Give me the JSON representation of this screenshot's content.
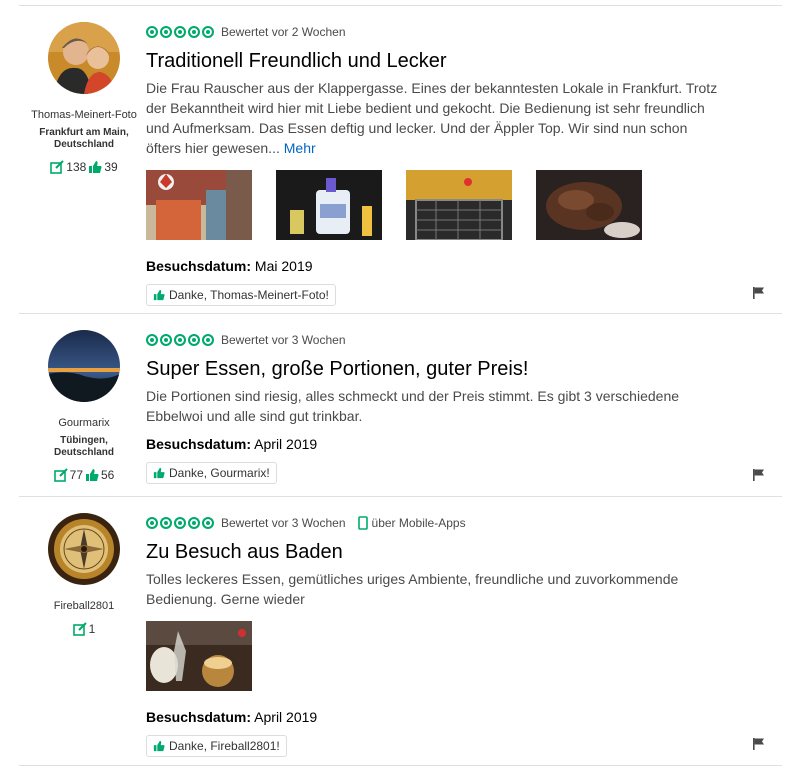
{
  "colors": {
    "accent": "#00aa6c",
    "link": "#0066c0"
  },
  "reviews": [
    {
      "user": {
        "name": "Thomas-Meinert-Foto",
        "location_line1": "Frankfurt am Main,",
        "location_line2": "Deutschland",
        "reviews": "138",
        "helpful": "39"
      },
      "rating": 5,
      "rated_text": "Bewertet vor 2 Wochen",
      "mobile_text": "",
      "title": "Traditionell Freundlich und Lecker",
      "body": "Die Frau Rauscher aus der Klappergasse. Eines der bekanntesten Lokale in Frankfurt. Trotz der Bekanntheit wird hier mit Liebe bedient und gekocht. Die Bedienung ist sehr freundlich und Aufmerksam. Das Essen deftig und lecker. Und der Äppler Top. Wir sind nun schon öfters hier gewesen...",
      "more": "Mehr",
      "visit_label": "Besuchsdatum:",
      "visit_date": "Mai 2019",
      "thanks": "Danke, Thomas-Meinert-Foto!"
    },
    {
      "user": {
        "name": "Gourmarix",
        "location_line1": "Tübingen,",
        "location_line2": "Deutschland",
        "reviews": "77",
        "helpful": "56"
      },
      "rating": 5,
      "rated_text": "Bewertet vor 3 Wochen",
      "mobile_text": "",
      "title": "Super Essen, große Portionen, guter Preis!",
      "body": "Die Portionen sind riesig, alles schmeckt und der Preis stimmt. Es gibt 3 verschiedene Ebbelwoi und alle sind gut trinkbar.",
      "visit_label": "Besuchsdatum:",
      "visit_date": "April 2019",
      "thanks": "Danke, Gourmarix!"
    },
    {
      "user": {
        "name": "Fireball2801",
        "reviews": "1"
      },
      "rating": 5,
      "rated_text": "Bewertet vor 3 Wochen",
      "mobile_text": "über Mobile-Apps",
      "title": "Zu Besuch aus Baden",
      "body": "Tolles leckeres Essen, gemütliches uriges Ambiente, freundliche und zuvorkommende Bedienung. Gerne wieder",
      "visit_label": "Besuchsdatum:",
      "visit_date": "April 2019",
      "thanks": "Danke, Fireball2801!"
    }
  ]
}
